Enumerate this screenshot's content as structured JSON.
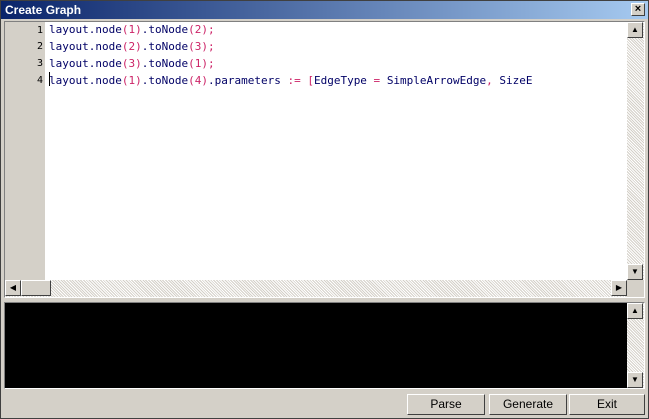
{
  "window": {
    "title": "Create Graph",
    "close_label": "×"
  },
  "editor": {
    "line_numbers": [
      "1",
      "2",
      "3",
      "4"
    ],
    "lines": [
      [
        {
          "t": "layout.node",
          "c": "kw"
        },
        {
          "t": "(1)",
          "c": "num"
        },
        {
          "t": ".toNode",
          "c": "kw"
        },
        {
          "t": "(2);",
          "c": "num"
        }
      ],
      [
        {
          "t": "layout.node",
          "c": "kw"
        },
        {
          "t": "(2)",
          "c": "num"
        },
        {
          "t": ".toNode",
          "c": "kw"
        },
        {
          "t": "(3);",
          "c": "num"
        }
      ],
      [
        {
          "t": "layout.node",
          "c": "kw"
        },
        {
          "t": "(3)",
          "c": "num"
        },
        {
          "t": ".toNode",
          "c": "kw"
        },
        {
          "t": "(1);",
          "c": "num"
        }
      ],
      [
        {
          "t": "layout.node",
          "c": "kw"
        },
        {
          "t": "(1)",
          "c": "num"
        },
        {
          "t": ".toNode",
          "c": "kw"
        },
        {
          "t": "(4)",
          "c": "num"
        },
        {
          "t": ".parameters",
          "c": "kw"
        },
        {
          "t": " := [",
          "c": "op"
        },
        {
          "t": "EdgeType",
          "c": "kw"
        },
        {
          "t": " = ",
          "c": "op"
        },
        {
          "t": "SimpleArrowEdge",
          "c": "kw"
        },
        {
          "t": ", ",
          "c": "op"
        },
        {
          "t": "SizeE",
          "c": "kw"
        }
      ]
    ]
  },
  "scroll": {
    "up": "▲",
    "down": "▼",
    "left": "◀",
    "right": "▶"
  },
  "buttons": {
    "parse": "Parse",
    "generate": "Generate",
    "exit": "Exit"
  },
  "colors": {
    "keyword": "#000066",
    "number": "#cc2266",
    "console_bg": "#000000"
  }
}
